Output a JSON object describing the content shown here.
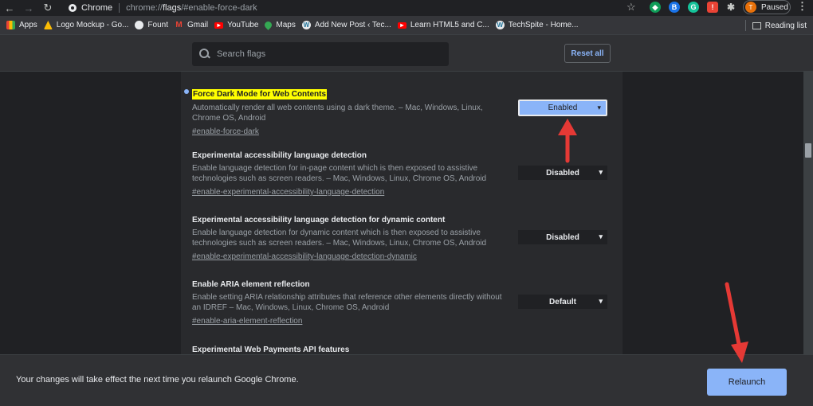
{
  "browser": {
    "tab_title": "Chrome",
    "url_prefix": "chrome://",
    "url_bold": "flags",
    "url_suffix": "/#enable-force-dark",
    "profile_initial": "T",
    "profile_status": "Paused"
  },
  "bookmarks": [
    {
      "label": "Apps",
      "icon": "apps-grid-icon",
      "color": "#ea4335"
    },
    {
      "label": "Logo Mockup - Go...",
      "icon": "drive-icon",
      "color": "#fbbc04"
    },
    {
      "label": "Fount",
      "icon": "globe-icon",
      "color": "#e8eaed"
    },
    {
      "label": "Gmail",
      "icon": "gmail-icon",
      "color": "#ea4335"
    },
    {
      "label": "YouTube",
      "icon": "youtube-icon",
      "color": "#ff0000"
    },
    {
      "label": "Maps",
      "icon": "maps-icon",
      "color": "#34a853"
    },
    {
      "label": "Add New Post ‹ Tec...",
      "icon": "wordpress-icon",
      "color": "#e8eaed"
    },
    {
      "label": "Learn HTML5 and C...",
      "icon": "youtube-icon",
      "color": "#ff0000"
    },
    {
      "label": "TechSpite - Home...",
      "icon": "wordpress-icon",
      "color": "#e8eaed"
    }
  ],
  "reading_list": "Reading list",
  "search": {
    "placeholder": "Search flags"
  },
  "reset_all": "Reset all",
  "flags": [
    {
      "title": "Force Dark Mode for Web Contents",
      "highlighted": true,
      "desc": "Automatically render all web contents using a dark theme. – Mac, Windows, Linux, Chrome OS, Android",
      "link": "#enable-force-dark",
      "value": "Enabled"
    },
    {
      "title": "Experimental accessibility language detection",
      "desc": "Enable language detection for in-page content which is then exposed to assistive technologies such as screen readers. – Mac, Windows, Linux, Chrome OS, Android",
      "link": "#enable-experimental-accessibility-language-detection",
      "value": "Disabled"
    },
    {
      "title": "Experimental accessibility language detection for dynamic content",
      "desc": "Enable language detection for dynamic content which is then exposed to assistive technologies such as screen readers. – Mac, Windows, Linux, Chrome OS, Android",
      "link": "#enable-experimental-accessibility-language-detection-dynamic",
      "value": "Disabled"
    },
    {
      "title": "Enable ARIA element reflection",
      "desc": "Enable setting ARIA relationship attributes that reference other elements directly without an IDREF – Mac, Windows, Linux, Chrome OS, Android",
      "link": "#enable-aria-element-reflection",
      "value": "Default"
    },
    {
      "title": "Experimental Web Payments API features"
    }
  ],
  "footer": {
    "message": "Your changes will take effect the next time you relaunch Google Chrome.",
    "relaunch": "Relaunch"
  },
  "colors": {
    "accent": "#8ab4f8",
    "annotation_arrow": "#e53935",
    "highlight": "#ffff00"
  }
}
